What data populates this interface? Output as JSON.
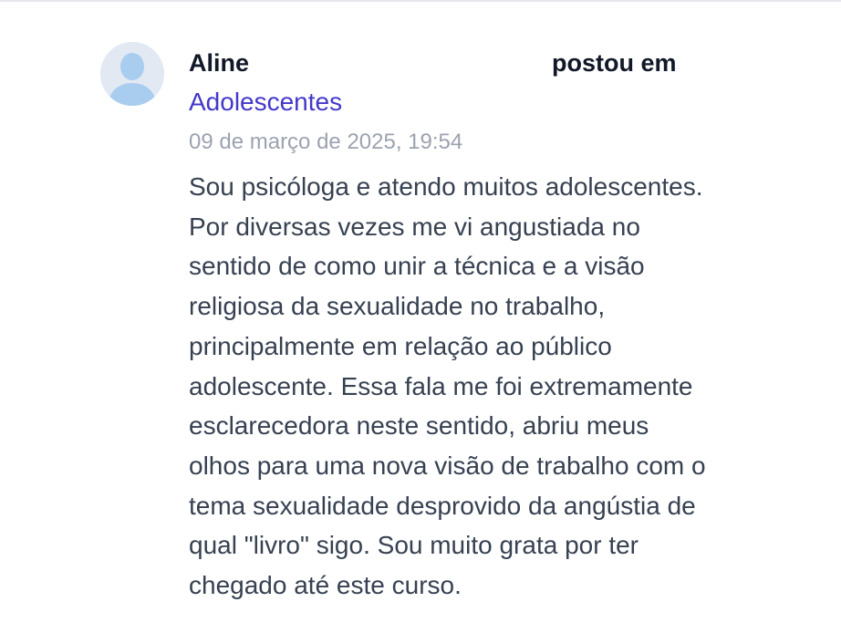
{
  "comment": {
    "author": "Aline",
    "action": "postou em",
    "group": "Adolescentes",
    "timestamp": "09 de março de 2025, 19:54",
    "body": "Sou psicóloga e atendo muitos adolescentes.\nPor diversas vezes me vi angustiada no\nsentido de como unir a técnica e a visão\nreligiosa da sexualidade no trabalho,\nprincipalmente em relação ao público\nadolescente. Essa fala me foi extremamente\nesclarecedora neste sentido, abriu meus\nolhos para uma nova visão de trabalho com o\ntema sexualidade desprovido da angústia de\nqual \"livro\" sigo. Sou muito grata por ter\nchegado até este curso.",
    "avatar_icon": "default-user-avatar-icon"
  },
  "colors": {
    "author": "#111827",
    "group_link": "#4338ca",
    "timestamp": "#9ca3af",
    "body": "#374151",
    "avatar_bg": "#e3e9f3",
    "avatar_figure": "#a9cdef"
  }
}
